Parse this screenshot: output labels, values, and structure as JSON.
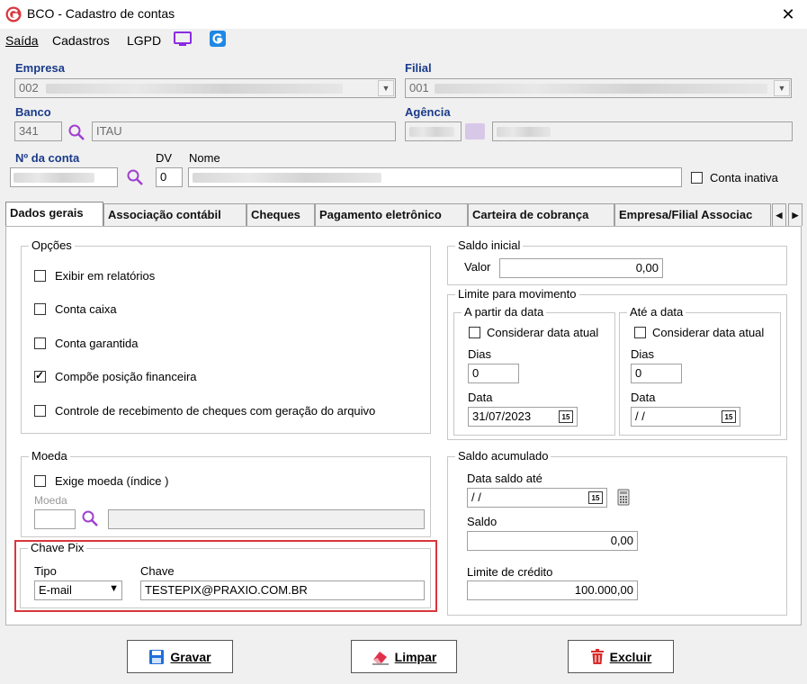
{
  "window": {
    "title": "BCO - Cadastro de contas",
    "close": "✕"
  },
  "menu": {
    "saida": "Saída",
    "cadastros": "Cadastros",
    "lgpd": "LGPD"
  },
  "empresa": {
    "label": "Empresa",
    "value": "002"
  },
  "filial": {
    "label": "Filial",
    "value": "001"
  },
  "banco": {
    "label": "Banco",
    "code": "341",
    "name": "ITAU"
  },
  "agencia": {
    "label": "Agência"
  },
  "conta": {
    "label": "Nº da conta",
    "dv_label": "DV",
    "dv_value": "0",
    "nome_label": "Nome",
    "inativa_label": "Conta inativa",
    "inativa_checked": false
  },
  "tabs": [
    "Dados gerais",
    "Associação contábil",
    "Cheques",
    "Pagamento eletrônico",
    "Carteira de cobrança",
    "Empresa/Filial Associac"
  ],
  "tab_nav": {
    "prev": "◀",
    "next": "▶"
  },
  "opcoes": {
    "title": "Opções",
    "items": [
      {
        "label": "Exibir em relatórios",
        "checked": false
      },
      {
        "label": "Conta caixa",
        "checked": false
      },
      {
        "label": "Conta garantida",
        "checked": false
      },
      {
        "label": "Compõe posição financeira",
        "checked": true
      },
      {
        "label": "Controle de recebimento de cheques com geração do arquivo",
        "checked": false
      }
    ]
  },
  "moeda": {
    "title": "Moeda",
    "exige_label": "Exige moeda (índice )",
    "exige_checked": false,
    "moeda_label": "Moeda"
  },
  "chave_pix": {
    "title": "Chave Pix",
    "tipo_label": "Tipo",
    "tipo_value": "E-mail",
    "chave_label": "Chave",
    "chave_value": "TESTEPIX@PRAXIO.COM.BR"
  },
  "saldo_inicial": {
    "title": "Saldo inicial",
    "valor_label": "Valor",
    "valor": "0,00"
  },
  "limite": {
    "title": "Limite para movimento",
    "apartir": {
      "title": "A partir da data",
      "considerar": "Considerar data atual",
      "dias_label": "Dias",
      "dias": "0",
      "data_label": "Data",
      "data": "31/07/2023"
    },
    "ate": {
      "title": "Até a data",
      "considerar": "Considerar data atual",
      "dias_label": "Dias",
      "dias": "0",
      "data_label": "Data",
      "data": " /  /"
    }
  },
  "saldo_acumulado": {
    "title": "Saldo acumulado",
    "data_label": "Data saldo até",
    "data": " /  /",
    "saldo_label": "Saldo",
    "saldo": "0,00",
    "limite_label": "Limite de crédito",
    "limite": "100.000,00"
  },
  "calendar_glyph": "15",
  "buttons": {
    "gravar": "Gravar",
    "limpar": "Limpar",
    "excluir": "Excluir"
  },
  "colors": {
    "accent": "#1a3b8a",
    "highlight": "#d9363e",
    "magnifier": "#a040d0"
  }
}
